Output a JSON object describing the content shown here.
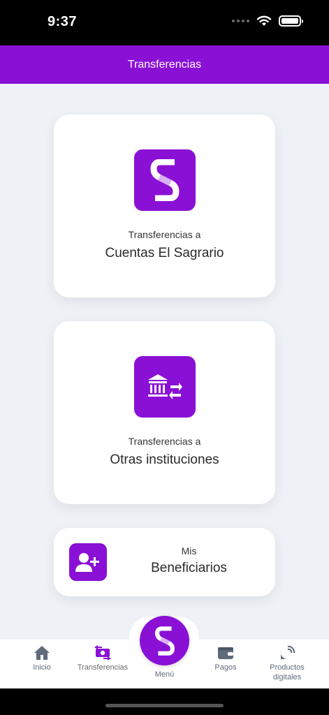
{
  "status_bar": {
    "time": "9:37"
  },
  "header": {
    "title": "Transferencias"
  },
  "cards": [
    {
      "icon": "sagrario-logo-icon",
      "subtitle": "Transferencias a",
      "title": "Cuentas El Sagrario"
    },
    {
      "icon": "bank-transfer-icon",
      "subtitle": "Transferencias a",
      "title": "Otras instituciones"
    },
    {
      "icon": "add-user-icon",
      "subtitle": "Mis",
      "title": "Beneficiarios"
    }
  ],
  "tabbar": {
    "items": [
      {
        "icon": "home-icon",
        "label": "Inicio"
      },
      {
        "icon": "money-transfer-icon",
        "label": "Transferencias"
      },
      {
        "icon": "sagrario-logo-icon",
        "label": "Menú"
      },
      {
        "icon": "wallet-icon",
        "label": "Pagos"
      },
      {
        "icon": "satellite-icon",
        "label_line1": "Productos",
        "label_line2": "digitales"
      }
    ]
  },
  "colors": {
    "brand": "#8a10d6",
    "background": "#eef1f5",
    "tab_icon": "#5f6b7a"
  }
}
